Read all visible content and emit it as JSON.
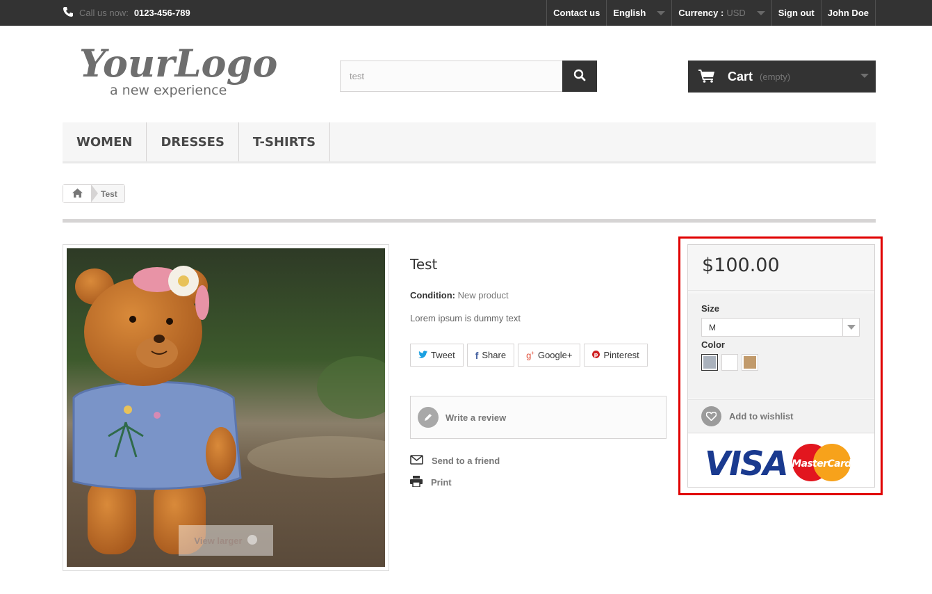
{
  "topbar": {
    "phone_label": "Call us now:",
    "phone_number": "0123-456-789",
    "contact": "Contact us",
    "language": "English",
    "currency_label": "Currency :",
    "currency_value": "USD",
    "signout": "Sign out",
    "user": "John Doe"
  },
  "logo": {
    "line1": "YourLogo",
    "line2": "a new experience"
  },
  "search": {
    "value": "test"
  },
  "cart": {
    "label": "Cart",
    "status": "(empty)"
  },
  "menu": {
    "items": [
      "WOMEN",
      "DRESSES",
      "T-SHIRTS"
    ]
  },
  "breadcrumb": {
    "current": "Test"
  },
  "image": {
    "view_larger": "View larger"
  },
  "product": {
    "title": "Test",
    "condition_label": "Condition:",
    "condition_value": "New product",
    "description": "Lorem ipsum is dummy text"
  },
  "social": {
    "tweet": "Tweet",
    "share": "Share",
    "google": "Google+",
    "pinterest": "Pinterest"
  },
  "actions": {
    "review": "Write a review",
    "send_friend": "Send to a friend",
    "print": "Print"
  },
  "buybox": {
    "price": "$100.00",
    "size_label": "Size",
    "size_value": "M",
    "color_label": "Color",
    "colors": [
      "#aab2bd",
      "#ffffff",
      "#c19a6b"
    ],
    "wishlist": "Add to wishlist",
    "visa": "VISA",
    "mastercard": "MasterCard"
  },
  "colors": {
    "highlight": "#e00000",
    "dark": "#333333"
  }
}
